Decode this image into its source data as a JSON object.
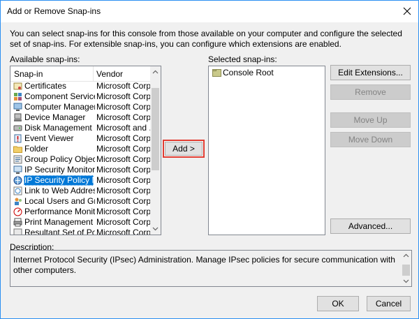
{
  "window": {
    "title": "Add or Remove Snap-ins"
  },
  "intro": "You can select snap-ins for this console from those available on your computer and configure the selected set of snap-ins. For extensible snap-ins, you can configure which extensions are enabled.",
  "available": {
    "label": "Available snap-ins:",
    "columns": {
      "snapin": "Snap-in",
      "vendor": "Vendor"
    },
    "items": [
      {
        "name": "Certificates",
        "vendor": "Microsoft Corp...",
        "icon": "certificates-icon"
      },
      {
        "name": "Component Services",
        "vendor": "Microsoft Corp...",
        "icon": "component-services-icon"
      },
      {
        "name": "Computer Managem...",
        "vendor": "Microsoft Corp...",
        "icon": "computer-management-icon"
      },
      {
        "name": "Device Manager",
        "vendor": "Microsoft Corp...",
        "icon": "device-manager-icon"
      },
      {
        "name": "Disk Management",
        "vendor": "Microsoft and ...",
        "icon": "disk-management-icon"
      },
      {
        "name": "Event Viewer",
        "vendor": "Microsoft Corp...",
        "icon": "event-viewer-icon"
      },
      {
        "name": "Folder",
        "vendor": "Microsoft Corp...",
        "icon": "folder-icon"
      },
      {
        "name": "Group Policy Object ...",
        "vendor": "Microsoft Corp...",
        "icon": "group-policy-icon"
      },
      {
        "name": "IP Security Monitor",
        "vendor": "Microsoft Corp...",
        "icon": "ip-security-monitor-icon"
      },
      {
        "name": "IP Security Policy Ma...",
        "vendor": "Microsoft Corp...",
        "icon": "ip-security-policy-icon"
      },
      {
        "name": "Link to Web Address",
        "vendor": "Microsoft Corp...",
        "icon": "web-link-icon"
      },
      {
        "name": "Local Users and Gro...",
        "vendor": "Microsoft Corp...",
        "icon": "local-users-icon"
      },
      {
        "name": "Performance Monitor",
        "vendor": "Microsoft Corp...",
        "icon": "performance-monitor-icon"
      },
      {
        "name": "Print Management",
        "vendor": "Microsoft Corp...",
        "icon": "print-management-icon"
      },
      {
        "name": "Resultant Set of Policy",
        "vendor": "Microsoft Corp...",
        "icon": "rsop-icon"
      }
    ],
    "selected_index": 9
  },
  "add_button": "Add >",
  "selected": {
    "label": "Selected snap-ins:",
    "items": [
      {
        "name": "Console Root",
        "icon": "folder-icon"
      }
    ]
  },
  "buttons": {
    "edit_extensions": "Edit Extensions...",
    "remove": "Remove",
    "move_up": "Move Up",
    "move_down": "Move Down",
    "advanced": "Advanced...",
    "ok": "OK",
    "cancel": "Cancel"
  },
  "description": {
    "label": "Description:",
    "text": "Internet Protocol Security (IPsec) Administration. Manage IPsec policies for secure communication with other computers."
  },
  "colors": {
    "selection": "#0078d7",
    "highlight_border": "#e03c31",
    "window_border": "#2b8ff2"
  }
}
